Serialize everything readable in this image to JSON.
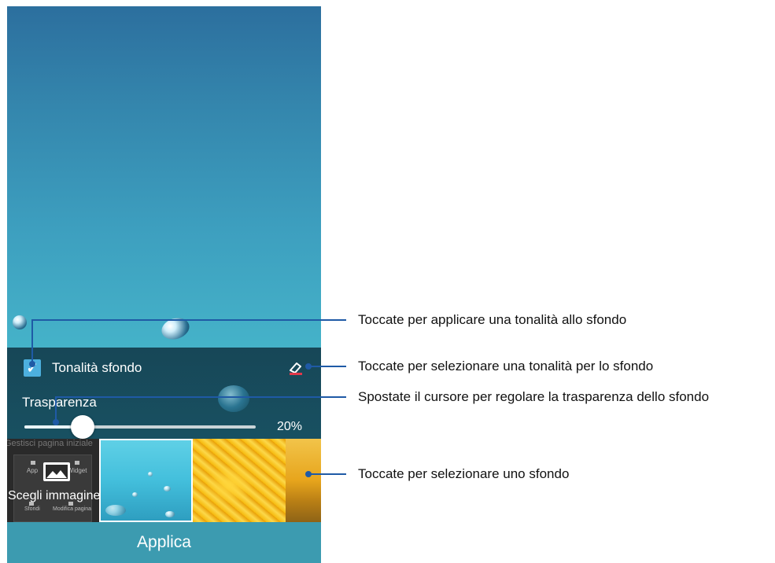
{
  "screen": {
    "panel": {
      "tint_checkbox_checked": true,
      "tint_label": "Tonalità sfondo",
      "transparency_label": "Trasparenza",
      "transparency_percent_text": "20%",
      "transparency_value": 0.2
    },
    "wallpapers": {
      "ghost_title": "Gestisci pagina iniziale",
      "ghost_app": "App",
      "ghost_widget": "Widget",
      "ghost_sfondi": "Sfondi",
      "ghost_modifica": "Modifica pagina",
      "choose_label": "Scegli immagine"
    },
    "apply_label": "Applica"
  },
  "callouts": {
    "tint_checkbox": "Toccate per applicare una tonalità allo sfondo",
    "tint_color": "Toccate per selezionare una tonalità per lo sfondo",
    "transparency": "Spostate il cursore per regolare la trasparenza dello sfondo",
    "wallpaper": "Toccate per selezionare uno sfondo"
  },
  "colors": {
    "callout_line": "#1f5aa6",
    "accent": "#4db0df",
    "apply_bar": "#3c9bb0"
  }
}
